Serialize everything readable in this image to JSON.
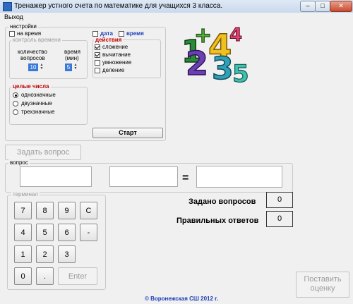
{
  "window": {
    "title": "Тренажер устного счета по математике для учащихся 3 класса.",
    "min_glyph": "–",
    "max_glyph": "□",
    "close_glyph": "✕"
  },
  "menu": {
    "exit": "Выход"
  },
  "settings": {
    "group_label": "настройки",
    "timed_label": "на время",
    "timed_checked": false,
    "date_label": "дата",
    "date_checked": false,
    "time_label": "время",
    "time_checked": false,
    "time_control": {
      "group_label": "контроль времени",
      "questions_label_1": "количество",
      "questions_label_2": "вопросов",
      "questions_value": "10",
      "minutes_label_1": "время",
      "minutes_label_2": "(мин)",
      "minutes_value": "5",
      "spin_up": "▲",
      "spin_down": "▼"
    },
    "actions": {
      "group_label": "действия",
      "items": [
        {
          "label": "сложение",
          "checked": true
        },
        {
          "label": "вычитание",
          "checked": true
        },
        {
          "label": "умножение",
          "checked": false
        },
        {
          "label": "деление",
          "checked": false
        }
      ]
    },
    "integers": {
      "group_label": "целые числа",
      "options": [
        {
          "label": "однозначные",
          "selected": true
        },
        {
          "label": "двузначные",
          "selected": false
        },
        {
          "label": "трехзначные",
          "selected": false
        }
      ]
    },
    "start_button": "Старт"
  },
  "ask_button": "Задать вопрос",
  "question": {
    "group_label": "вопрос",
    "operand1": "",
    "operand2": "",
    "equals": "=",
    "answer": ""
  },
  "terminal": {
    "group_label": "терминал",
    "keys": [
      "7",
      "8",
      "9",
      "C",
      "4",
      "5",
      "6",
      "-",
      "1",
      "2",
      "3",
      "0",
      ".",
      "Enter"
    ]
  },
  "stats": {
    "asked_label": "Задано вопросов",
    "asked_value": "0",
    "correct_label": "Правильных ответов",
    "correct_value": "0"
  },
  "grade_button_line1": "Поставить",
  "grade_button_line2": "оценку",
  "footer": "©  Воронежская  СШ 2012 г.",
  "colors": {
    "accent_blue": "#1a3cb8",
    "actions_red": "#c00000",
    "spin_blue": "#3b79d8"
  },
  "logo": {
    "icon": "colorful-numbers-icon",
    "digits": [
      "1",
      "2",
      "3",
      "4",
      "5",
      "+"
    ]
  }
}
